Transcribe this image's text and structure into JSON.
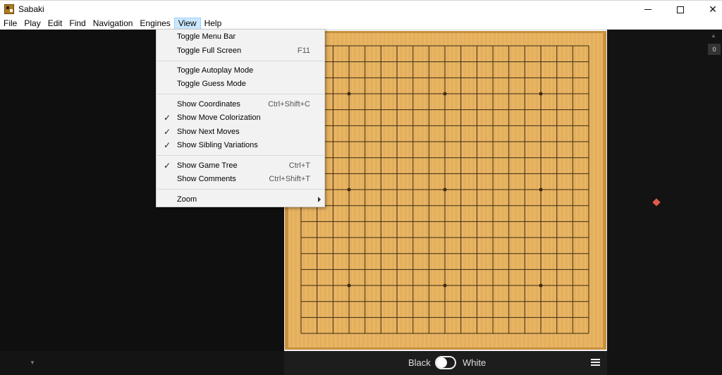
{
  "window": {
    "title": "Sabaki"
  },
  "menubar": {
    "items": [
      "File",
      "Play",
      "Edit",
      "Find",
      "Navigation",
      "Engines",
      "View",
      "Help"
    ],
    "active": "View"
  },
  "view_menu": {
    "items": [
      {
        "label": "Toggle Menu Bar",
        "shortcut": "",
        "checked": false
      },
      {
        "label": "Toggle Full Screen",
        "shortcut": "F11",
        "checked": false
      },
      {
        "label": "Toggle Autoplay Mode",
        "shortcut": "",
        "checked": false
      },
      {
        "label": "Toggle Guess Mode",
        "shortcut": "",
        "checked": false
      },
      {
        "label": "Show Coordinates",
        "shortcut": "Ctrl+Shift+C",
        "checked": false
      },
      {
        "label": "Show Move Colorization",
        "shortcut": "",
        "checked": true
      },
      {
        "label": "Show Next Moves",
        "shortcut": "",
        "checked": true
      },
      {
        "label": "Show Sibling Variations",
        "shortcut": "",
        "checked": true
      },
      {
        "label": "Show Game Tree",
        "shortcut": "Ctrl+T",
        "checked": true
      },
      {
        "label": "Show Comments",
        "shortcut": "Ctrl+Shift+T",
        "checked": false
      },
      {
        "label": "Zoom",
        "shortcut": "",
        "checked": false,
        "submenu": true
      }
    ]
  },
  "board": {
    "size": 19,
    "star_points": [
      [
        3,
        3
      ],
      [
        9,
        3
      ],
      [
        15,
        3
      ],
      [
        3,
        9
      ],
      [
        9,
        9
      ],
      [
        15,
        9
      ],
      [
        3,
        15
      ],
      [
        9,
        15
      ],
      [
        15,
        15
      ]
    ]
  },
  "players": {
    "black": "Black",
    "white": "White",
    "current": "black"
  },
  "game_tree": {
    "move_number": "0",
    "node_color": "#e45a4a"
  },
  "colors": {
    "board": "#e8b25d",
    "grid": "#3b2a14",
    "background": "#111111"
  }
}
